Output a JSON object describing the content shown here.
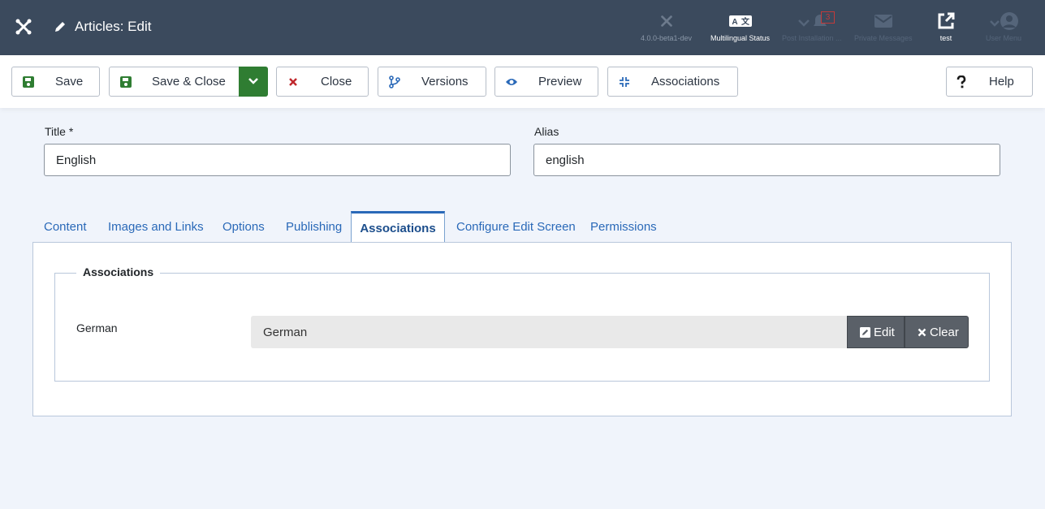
{
  "header": {
    "title": "Articles: Edit",
    "items": {
      "version": {
        "label": "4.0.0-beta1-dev"
      },
      "multilingual": {
        "label": "Multilingual Status"
      },
      "post_install": {
        "label": "Post Installation ...",
        "count": "3"
      },
      "messages": {
        "label": "Private Messages"
      },
      "site": {
        "label": "test"
      },
      "user": {
        "label": "User Menu"
      }
    }
  },
  "toolbar": {
    "save": "Save",
    "save_close": "Save & Close",
    "close": "Close",
    "versions": "Versions",
    "preview": "Preview",
    "associations": "Associations",
    "help": "Help"
  },
  "form": {
    "title_label": "Title *",
    "title_value": "English",
    "alias_label": "Alias",
    "alias_value": "english"
  },
  "tabs": [
    "Content",
    "Images and Links",
    "Options",
    "Publishing",
    "Associations",
    "Configure Edit Screen",
    "Permissions"
  ],
  "active_tab": "Associations",
  "associations": {
    "legend": "Associations",
    "rows": [
      {
        "language": "German",
        "value": "German",
        "edit": "Edit",
        "clear": "Clear"
      }
    ]
  },
  "colors": {
    "header_bg": "#3b4a5d",
    "save_green": "#2f7d32",
    "close_red": "#c0282d",
    "link_blue": "#2a69b8"
  }
}
